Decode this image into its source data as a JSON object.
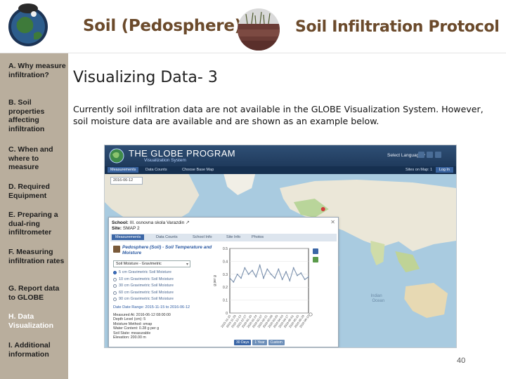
{
  "header": {
    "title_left": "Soil (Pedosphere)",
    "title_right": "Soil Infiltration Protocol"
  },
  "sidebar": {
    "items": [
      {
        "label": "A. Why measure infiltration?",
        "active": false
      },
      {
        "label": "B. Soil properties affecting infiltration",
        "active": false
      },
      {
        "label": "C. When and where to measure",
        "active": false
      },
      {
        "label": "D. Required Equipment",
        "active": false
      },
      {
        "label": "E. Preparing a dual-ring infiltrometer",
        "active": false
      },
      {
        "label": "F. Measuring infiltration rates",
        "active": false
      },
      {
        "label": "G. Report data to GLOBE",
        "active": false
      },
      {
        "label": "H. Data Visualization",
        "active": true
      },
      {
        "label": "I. Additional information",
        "active": false
      }
    ]
  },
  "content": {
    "title": "Visualizing Data- 3",
    "body": "Currently soil infiltration data are not available in the GLOBE Visualization System. However, soil moisture data are available and are shown as an example below."
  },
  "page_number": "40",
  "visualization": {
    "app_title": "THE GLOBE PROGRAM",
    "app_subtitle": "Visualization System",
    "select_language": "Select Language ▾",
    "nav_tabs": [
      "Measurements",
      "Data Counts",
      "Choose Base Map"
    ],
    "sites_on_map": "Sites on Map: 1",
    "login": "Log In",
    "date_box": "2016-06-12",
    "school_label": "School:",
    "school_value": "III. osnovna skola Varazdin",
    "site_label": "Site:",
    "site_value": "SMAP 2",
    "panel_tabs": [
      "Measurements",
      "Data Counts",
      "School Info",
      "Site Info",
      "Photos"
    ],
    "protocol_title": "Pedosphere (Soil) - Soil Temperature and Moisture",
    "selected_measure": "Soil Moisture - Gravimetric",
    "depth_options": [
      {
        "label": "5 cm Gravimetric Soil Moisture",
        "selected": true
      },
      {
        "label": "10 cm Gravimetric Soil Moisture",
        "selected": false
      },
      {
        "label": "30 cm Gravimetric Soil Moisture",
        "selected": false
      },
      {
        "label": "60 cm Gravimetric Soil Moisture",
        "selected": false
      },
      {
        "label": "90 cm Gravimetric Soil Moisture",
        "selected": false
      }
    ],
    "date_range": "Date Date Range: 2015-11-15 to 2016-06-12",
    "meta": [
      "Measured At: 2016-06-12 08:00:00",
      "Depth Level (cm): 5",
      "Moisture Method: smap",
      "Water Content: 0.28 g per g",
      "Soil State: measurable",
      "Elevation: 200.00 m"
    ],
    "time_buttons": [
      {
        "label": "30 Days",
        "selected": true
      },
      {
        "label": "1 Year",
        "selected": false
      },
      {
        "label": "Custom",
        "selected": false
      }
    ],
    "colors": {
      "header_bar": "#2f4f75",
      "accent_blue": "#2a58a1",
      "sidebar_bg": "#b9ae9d",
      "title_brown": "#6b4a2b",
      "line_series": "#7a90ad"
    }
  },
  "chart_data": {
    "type": "line",
    "title": "",
    "xlabel": "",
    "ylabel": "g per g",
    "ylim": [
      0,
      0.5
    ],
    "yticks": [
      0,
      0.1,
      0.2,
      0.3,
      0.4,
      0.5
    ],
    "x": [
      "2015-11-15",
      "2015-11-25",
      "2015-12-05",
      "2015-12-15",
      "2015-12-25",
      "2016-01-04",
      "2016-01-14",
      "2016-01-24",
      "2016-02-03",
      "2016-02-13",
      "2016-02-23",
      "2016-03-04",
      "2016-03-14",
      "2016-03-24",
      "2016-04-03",
      "2016-04-13",
      "2016-04-23",
      "2016-05-03",
      "2016-05-13",
      "2016-05-23",
      "2016-06-02",
      "2016-06-12"
    ],
    "xtick_labels": [
      "2015-11-15",
      "2015-11-29",
      "2015-12-13",
      "2015-12-27",
      "2016-01-10",
      "2016-01-24",
      "2016-02-07",
      "2016-02-21",
      "2016-03-06",
      "2016-03-20",
      "2016-04-03",
      "2016-04-17",
      "2016-05-01",
      "2016-05-15",
      "2016-05-29",
      "2016-06-12"
    ],
    "series": [
      {
        "name": "",
        "values": [
          0.27,
          0.24,
          0.3,
          0.27,
          0.35,
          0.3,
          0.33,
          0.28,
          0.37,
          0.27,
          0.34,
          0.3,
          0.27,
          0.34,
          0.26,
          0.32,
          0.25,
          0.35,
          0.29,
          0.31,
          0.26,
          0.28
        ]
      }
    ],
    "grid": true,
    "legend": "none"
  }
}
